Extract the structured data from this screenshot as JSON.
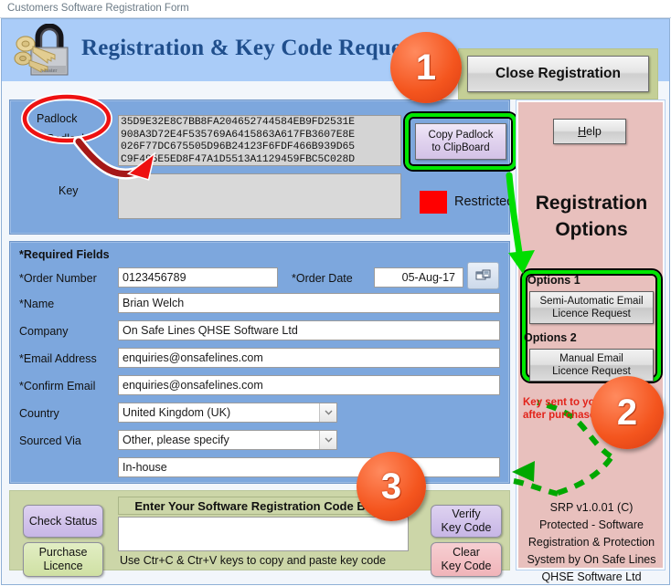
{
  "window": {
    "titlebar": "Customers Software Registration Form"
  },
  "header": {
    "title": "Registration & Key Code Request",
    "padlock_icon": "padlock-keys-icon",
    "close_button": "Close Registration"
  },
  "padlock_panel": {
    "padlock_label": "Padlock",
    "key_label": "Key",
    "padlock_code": "35D9E32E8C7BB8FA204652744584EB9FD2531E\n908A3D72E4F535769A6415863A617FB3607E8E\n026F77DC675505D96B24123F6FDF466B939D65\nC9F495E5ED8F47A1D5513A1129459FBC5C028D",
    "key_value": "",
    "copy_button": "Copy Padlock\nto ClipBoard",
    "copy_button_line1": "Copy Padlock",
    "copy_button_line2": "to ClipBoard",
    "restricted_label": "Restricted",
    "restricted_color": "#ff0000"
  },
  "form": {
    "required_fields_note": "*Required Fields",
    "fields": [
      {
        "label": "*Order Number",
        "value": "0123456789"
      },
      {
        "label": "*Order Date",
        "value": "05-Aug-17"
      },
      {
        "label": "*Name",
        "value": "Brian Welch"
      },
      {
        "label": "Company",
        "value": "On Safe Lines QHSE Software Ltd"
      },
      {
        "label": "*Email Address",
        "value": "enquiries@onsafelines.com"
      },
      {
        "label": "*Confirm Email",
        "value": "enquiries@onsafelines.com"
      },
      {
        "label": "Country",
        "value": "United Kingdom (UK)"
      },
      {
        "label": "Sourced Via",
        "value": "Other, please specify"
      },
      {
        "label": "",
        "value": "In-house"
      }
    ],
    "calendar_icon": "calendar-picker-icon"
  },
  "options_panel": {
    "help_button": "Help",
    "help_accel": "H",
    "help_rest": "elp",
    "title_line1": "Registration",
    "title_line2": "Options",
    "option1_label": "Options 1",
    "option1_btn_line1": "Semi-Automatic Email",
    "option1_btn_line2": "Licence Request",
    "option2_label": "Options 2",
    "option2_btn_line1": "Manual Email",
    "option2_btn_line2": "Licence Request",
    "srp_lines": "SRP v1.0.01 (C)\nProtected - Software\nRegistration & Protection\nSystem by On Safe Lines\nQHSE Software Ltd"
  },
  "bottom_panel": {
    "check_status_btn": "Check Status",
    "purchase_line1": "Purchase",
    "purchase_line2": "Licence",
    "code_header": "Enter Your Software Registration Code Below",
    "code_value": "",
    "hint": "Use Ctr+C & Ctr+V keys to copy and paste key code",
    "verify_line1": "Verify",
    "verify_line2": "Key Code",
    "clear_line1": "Clear",
    "clear_line2": "Key Code"
  },
  "annotations": {
    "badge1": "1",
    "badge2": "2",
    "badge3": "3",
    "key_note_line1": "Key sent to you",
    "key_note_line2": "after purchase",
    "highlight_color": "#00e800",
    "badge_color": "#f4551e",
    "arrow_red_color": "#a51818"
  }
}
